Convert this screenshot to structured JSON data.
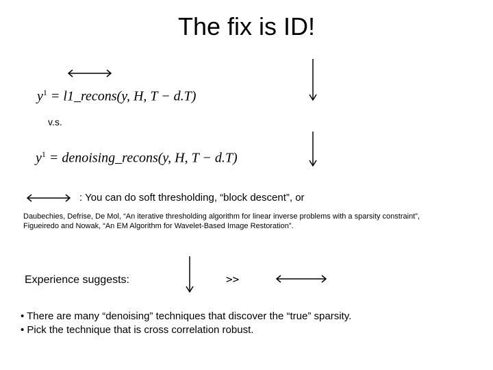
{
  "title": "The fix is ID!",
  "eq1_html": "y<span class='sup'>1</span> = <span class='fn'>l</span>1_<span class='fn'>recons</span>(y, H, T − d.T)",
  "vs": "v.s.",
  "eq2_html": "y<span class='sup'>1</span> = <span class='fn'>denoising</span>_<span class='fn'>recons</span>(y, H, T − d.T)",
  "soft_line": ": You can do soft thresholding, “block descent”, or",
  "refs_line1": "Daubechies, Defrise, De Mol, “An iterative thresholding algorithm for linear inverse problems with a sparsity constraint”,",
  "refs_line2": "Figueiredo and Nowak, “An EM Algorithm for Wavelet-Based Image Restoration”.",
  "experience": "Experience suggests:",
  "gtgt": ">>",
  "bullet1": "• There are many “denoising” techniques that discover the “true” sparsity.",
  "bullet2": "• Pick the technique that is cross correlation robust."
}
